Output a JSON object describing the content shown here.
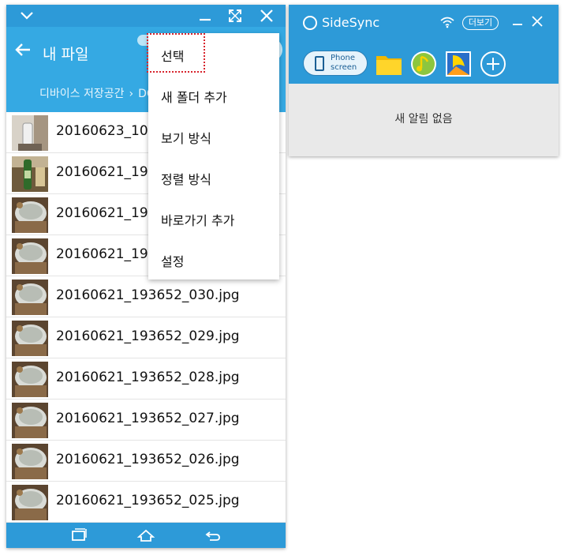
{
  "phone_window": {
    "titlebar": {
      "collapse_icon": "chevron-down-icon",
      "minimize_icon": "minimize-icon",
      "fullscreen_icon": "expand-icon",
      "close_icon": "close-icon"
    },
    "header": {
      "title": "내 파일",
      "breadcrumb": [
        "디바이스 저장공간",
        "DC"
      ],
      "accent_color": "#35a9e3"
    },
    "files": [
      {
        "name": "20160623_1022",
        "thumb": "glass"
      },
      {
        "name": "20160621_1941",
        "thumb": "bottle"
      },
      {
        "name": "20160621_1936",
        "thumb": "food"
      },
      {
        "name": "20160621_1936",
        "thumb": "food"
      },
      {
        "name": "20160621_193652_030.jpg",
        "thumb": "food"
      },
      {
        "name": "20160621_193652_029.jpg",
        "thumb": "food"
      },
      {
        "name": "20160621_193652_028.jpg",
        "thumb": "food"
      },
      {
        "name": "20160621_193652_027.jpg",
        "thumb": "food"
      },
      {
        "name": "20160621_193652_026.jpg",
        "thumb": "food"
      },
      {
        "name": "20160621_193652_025.jpg",
        "thumb": "food"
      },
      {
        "name": "",
        "thumb": "food"
      }
    ],
    "popup_menu": [
      "선택",
      "새 폴더 추가",
      "보기 방식",
      "정렬 방식",
      "바로가기 추가",
      "설정"
    ],
    "nav_icons": [
      "recent-apps-icon",
      "home-icon",
      "back-icon"
    ]
  },
  "sidesync": {
    "title": "SideSync",
    "more_label": "더보기",
    "phone_screen_label_line1": "Phone",
    "phone_screen_label_line2": "screen",
    "apps": [
      "folder-icon",
      "music-icon",
      "gallery-icon",
      "add-icon"
    ],
    "notice": "새 알림 없음",
    "accent_color": "#2d9ad8"
  }
}
